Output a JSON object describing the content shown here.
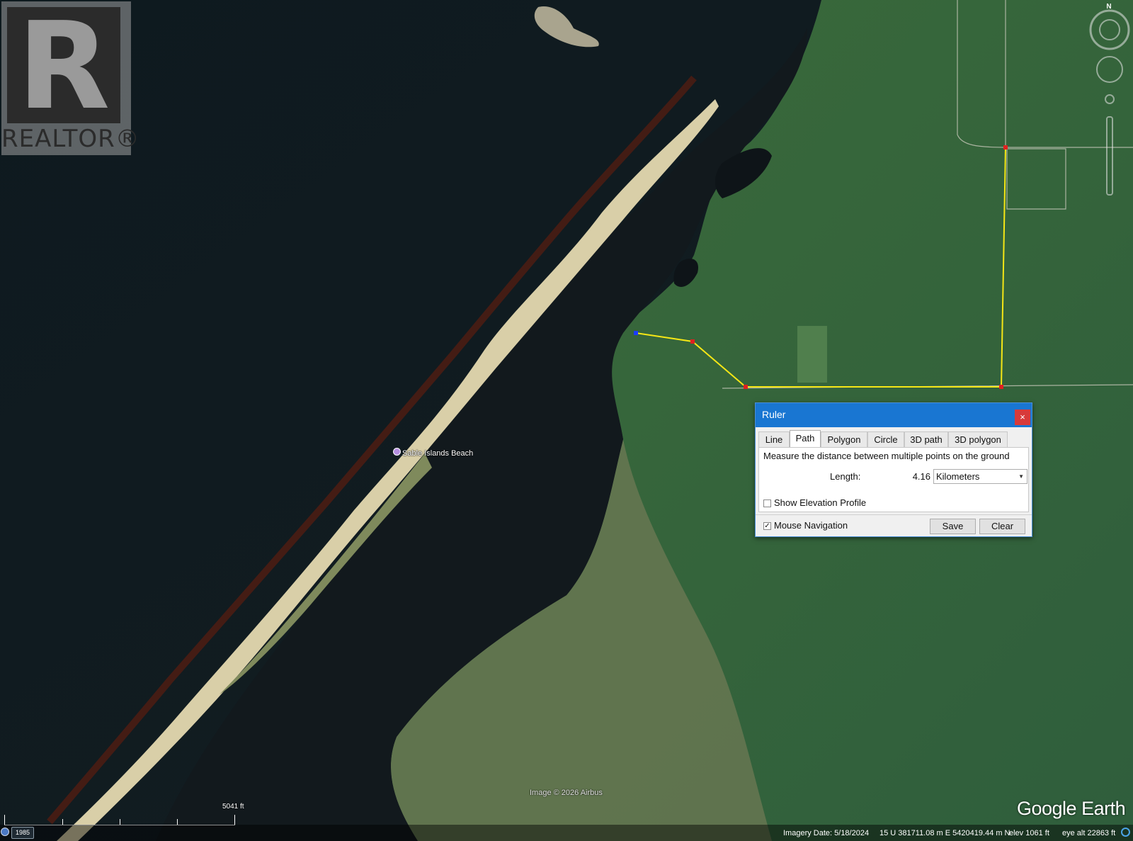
{
  "map": {
    "place_label": "Sable Islands Beach",
    "image_credit": "Image © 2026 Airbus",
    "logo": "Google Earth",
    "scale_label": "5041 ft",
    "compass_letter": "N",
    "realtor_mark": "R",
    "realtor_text": "REALTOR®",
    "path_color": "#f5e616",
    "vertex_color": "#e02020",
    "start_vertex_color": "#1a3cff"
  },
  "status": {
    "historical_year": "1985",
    "imagery_date": "Imagery Date: 5/18/2024",
    "coordinates": "15 U 381711.08 m E 5420419.44 m N",
    "elevation": "elev  1061 ft",
    "eye_alt": "eye alt  22863 ft"
  },
  "ruler": {
    "title": "Ruler",
    "close": "×",
    "tabs": [
      "Line",
      "Path",
      "Polygon",
      "Circle",
      "3D path",
      "3D polygon"
    ],
    "active_tab": "Path",
    "description": "Measure the distance between multiple points on the ground",
    "length_label": "Length:",
    "length_value": "4.16",
    "unit": "Kilometers",
    "show_elevation_profile": "Show Elevation Profile",
    "mouse_navigation": "Mouse Navigation",
    "check_mark": "✓",
    "save": "Save",
    "clear": "Clear",
    "accent": "#1976d2"
  }
}
